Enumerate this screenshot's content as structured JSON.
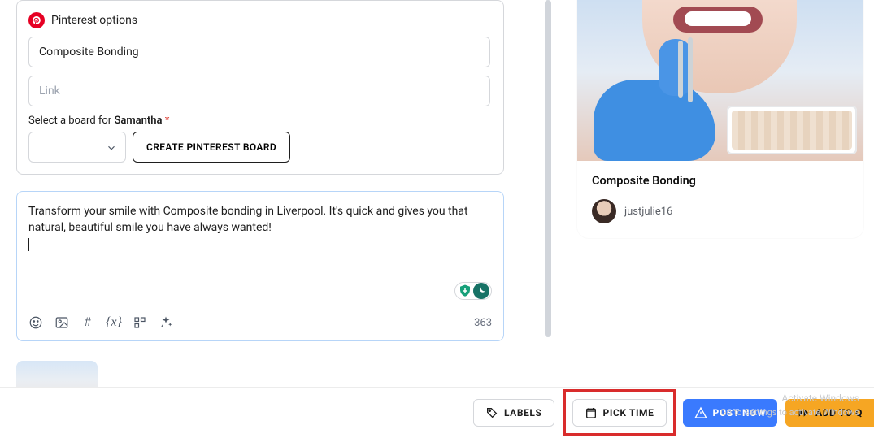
{
  "pinterest": {
    "panel_title": "Pinterest options",
    "title_value": "Composite Bonding",
    "link_placeholder": "Link",
    "board_label_prefix": "Select a board for ",
    "board_label_name": "Samantha",
    "board_label_required": "*",
    "create_board_btn": "CREATE PINTEREST BOARD"
  },
  "compose": {
    "text": "Transform your smile with Composite bonding in Liverpool. It's quick and gives you that natural, beautiful smile you have always wanted!",
    "char_count": "363"
  },
  "preview": {
    "title": "Composite Bonding",
    "author": "justjulie16"
  },
  "footer": {
    "labels": "LABELS",
    "pick_time": "PICK TIME",
    "post_now": "POST NOW",
    "add_queue": "ADD TO Q",
    "watermark1": "Activate Windows",
    "watermark2": "Go to Settings to activate Windows"
  }
}
